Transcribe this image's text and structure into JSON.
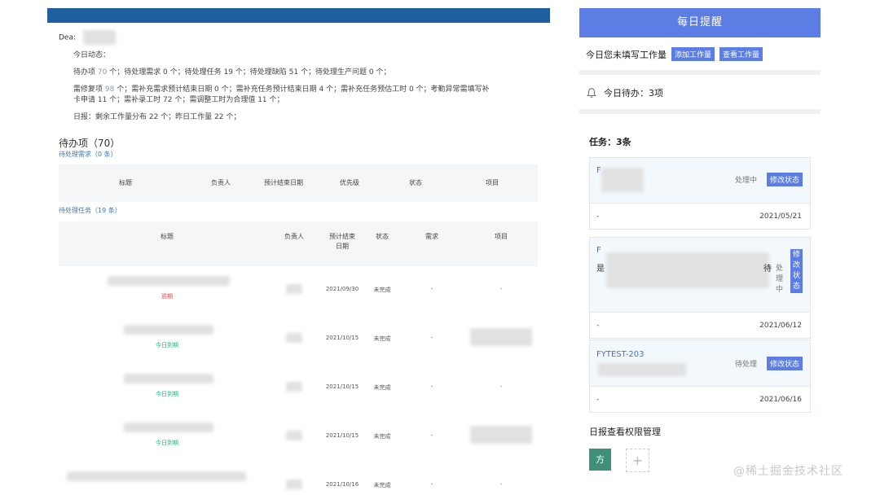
{
  "email": {
    "greeting": "Dea",
    "summary_heading": "今日动态：",
    "line1": [
      {
        "t": "待办项 "
      },
      {
        "t": "70",
        "n": true
      },
      {
        "t": " 个；待处理需求 0 个；待处理任务 19 个；待处理缺陷 51 个；待处理生产问题 0 个；"
      }
    ],
    "line2a": [
      {
        "t": "需修复项 "
      },
      {
        "t": "98",
        "n": true
      },
      {
        "t": " 个；需补充需求预计结束日期 0 个；需补充任务预计结束日期 4 个；需补充任务预估工时 0 个；考勤异常需填写补"
      }
    ],
    "line2b": "卡申请 11 个；需补录工时 72 个；需调整工时为合理值 11 个；",
    "line3": "日报：剩余工作量分布 22 个；昨日工作量 22 个；",
    "todo_title": "待办项（70）",
    "req_title": "待处理需求（0 条）",
    "req_headers": [
      "标题",
      "负责人",
      "预计结束日期",
      "优先级",
      "状态",
      "项目"
    ],
    "task_title": "待处理任务（19 条）",
    "task_headers": [
      "标题",
      "负责人",
      "预计结束\n日期",
      "状态",
      "需求",
      "项目"
    ],
    "task_rows": [
      {
        "tag": "逾期",
        "tag_type": "red",
        "date": "2021/09/30",
        "status": "未完成",
        "req": "-",
        "proj": "-"
      },
      {
        "tag": "今日到期",
        "tag_type": "green",
        "date": "2021/10/15",
        "status": "未完成",
        "req": "-",
        "proj": ""
      },
      {
        "tag": "今日到期",
        "tag_type": "green",
        "date": "2021/10/15",
        "status": "未完成",
        "req": "-",
        "proj": "-"
      },
      {
        "tag": "今日到期",
        "tag_type": "green",
        "date": "2021/10/15",
        "status": "未完成",
        "req": "-",
        "proj": ""
      },
      {
        "tag": "",
        "tag_type": "",
        "date": "2021/10/16",
        "status": "未完成",
        "req": "-",
        "proj": "-"
      }
    ]
  },
  "panel": {
    "header": "每日提醒",
    "notice": "今日您未填写工作量",
    "add_btn": "添加工作量",
    "view_btn": "查看工作量",
    "todo_today": "今日待办：3项",
    "task_count": "任务：3条",
    "cards": [
      {
        "code": "F",
        "status": "处理中",
        "edit": "修改状态",
        "foot_left": "-",
        "date": "2021/05/21"
      },
      {
        "code": "F",
        "extra": "是",
        "extra2": "待",
        "status": "处\n理\n中",
        "edit": "修\n改\n状\n态",
        "foot_left": "-",
        "date": "2021/06/12"
      },
      {
        "code": "FYTEST-203",
        "status": "待处理",
        "edit": "修改状态",
        "foot_left": "-",
        "date": "2021/06/16"
      }
    ],
    "perm_title": "日报查看权限管理",
    "avatar_text": "方",
    "add_symbol": "+"
  },
  "watermark": "@稀土掘金技术社区",
  "colors": {
    "accent": "#5b7de4",
    "email_bar": "#1f5fa0",
    "overdue": "#e24a4a",
    "due_today": "#2bae7e"
  },
  "icons": {
    "bell": "bell-icon",
    "plus": "plus-icon"
  }
}
